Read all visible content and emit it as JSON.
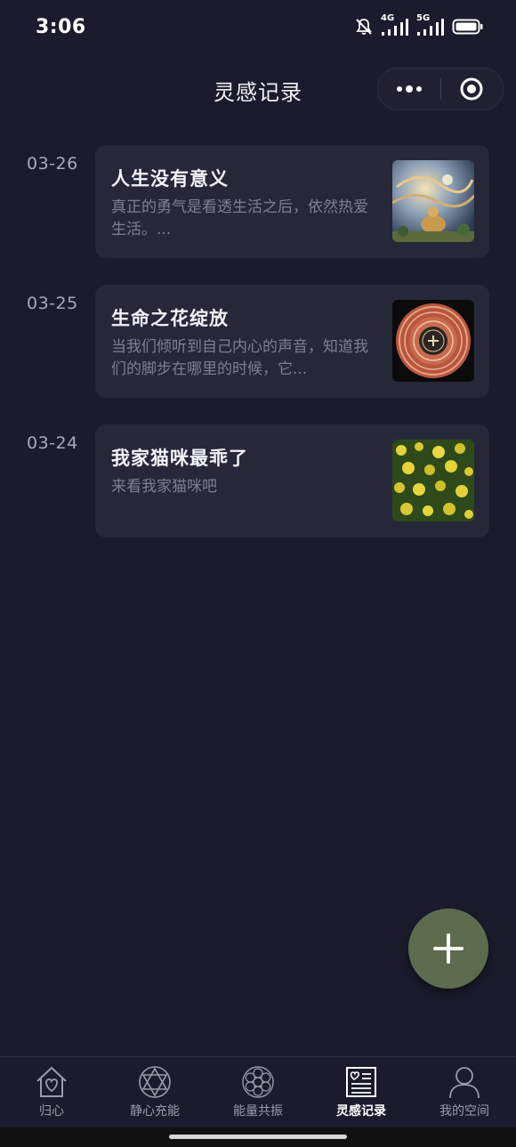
{
  "status_bar": {
    "time": "3:06",
    "net1": "4G",
    "net2": "5G"
  },
  "header": {
    "title": "灵感记录",
    "more_icon": "more-dots-icon",
    "close_icon": "target-circle-icon"
  },
  "records": [
    {
      "date": "03-26",
      "title": "人生没有意义",
      "excerpt": "真正的勇气是看透生活之后，依然热爱生活。...",
      "thumb": "cosmic-buddha-image"
    },
    {
      "date": "03-25",
      "title": "生命之花绽放",
      "excerpt": "当我们倾听到自己内心的声音，知道我们的脚步在哪里的时候，它...",
      "thumb": "mandala-image"
    },
    {
      "date": "03-24",
      "title": "我家猫咪最乖了",
      "excerpt": "来看我家猫咪吧",
      "thumb": "rapeseed-flowers-image"
    }
  ],
  "fab": {
    "icon": "plus-icon"
  },
  "tabs": [
    {
      "label": "归心",
      "icon": "house-heart-icon",
      "active": false
    },
    {
      "label": "静心充能",
      "icon": "hexagram-icon",
      "active": false
    },
    {
      "label": "能量共振",
      "icon": "flower-of-life-icon",
      "active": false
    },
    {
      "label": "灵感记录",
      "icon": "notebook-heart-icon",
      "active": true
    },
    {
      "label": "我的空间",
      "icon": "person-icon",
      "active": false
    }
  ],
  "colors": {
    "background": "#1b1b2d",
    "card": "#262739",
    "fab": "#5d6b4f"
  }
}
